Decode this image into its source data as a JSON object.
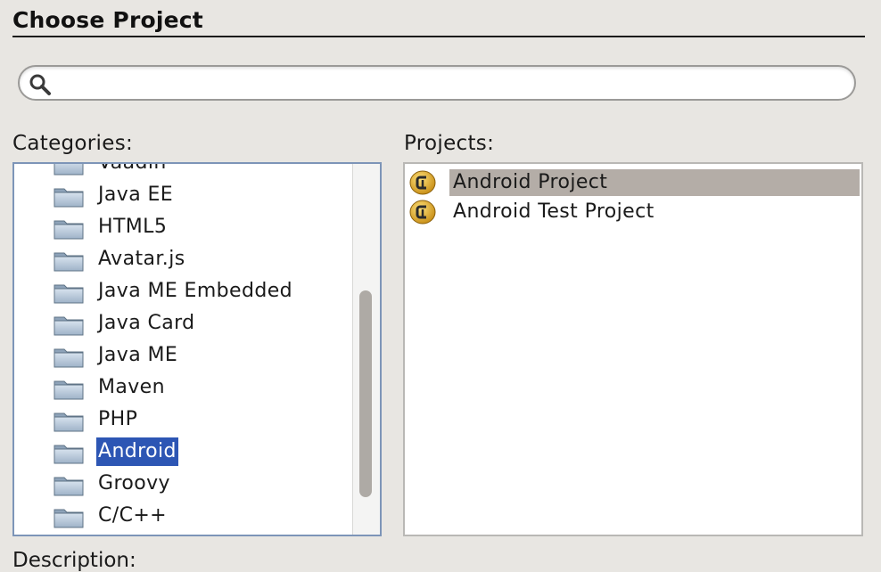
{
  "dialog": {
    "title": "Choose Project"
  },
  "search": {
    "value": "",
    "placeholder": "",
    "icon": "search-icon"
  },
  "categories": {
    "label": "Categories:",
    "items": [
      {
        "label": "Vaadin",
        "icon": "folder-icon"
      },
      {
        "label": "Java EE",
        "icon": "folder-icon"
      },
      {
        "label": "HTML5",
        "icon": "folder-icon"
      },
      {
        "label": "Avatar.js",
        "icon": "folder-icon"
      },
      {
        "label": "Java ME Embedded",
        "icon": "folder-icon"
      },
      {
        "label": "Java Card",
        "icon": "folder-icon"
      },
      {
        "label": "Java ME",
        "icon": "folder-icon"
      },
      {
        "label": "Maven",
        "icon": "folder-icon"
      },
      {
        "label": "PHP",
        "icon": "folder-icon"
      },
      {
        "label": "Android",
        "icon": "folder-icon",
        "selected": true
      },
      {
        "label": "Groovy",
        "icon": "folder-icon"
      },
      {
        "label": "C/C++",
        "icon": "folder-icon"
      }
    ]
  },
  "projects": {
    "label": "Projects:",
    "items": [
      {
        "label": "Android Project",
        "icon": "android-project-icon",
        "selected": true
      },
      {
        "label": "Android Test Project",
        "icon": "android-project-icon"
      }
    ]
  },
  "description": {
    "label": "Description:"
  },
  "colors": {
    "category_selection": "#2d56b4",
    "project_selection": "#b4ada7",
    "categories_border": "#7d95b8"
  }
}
